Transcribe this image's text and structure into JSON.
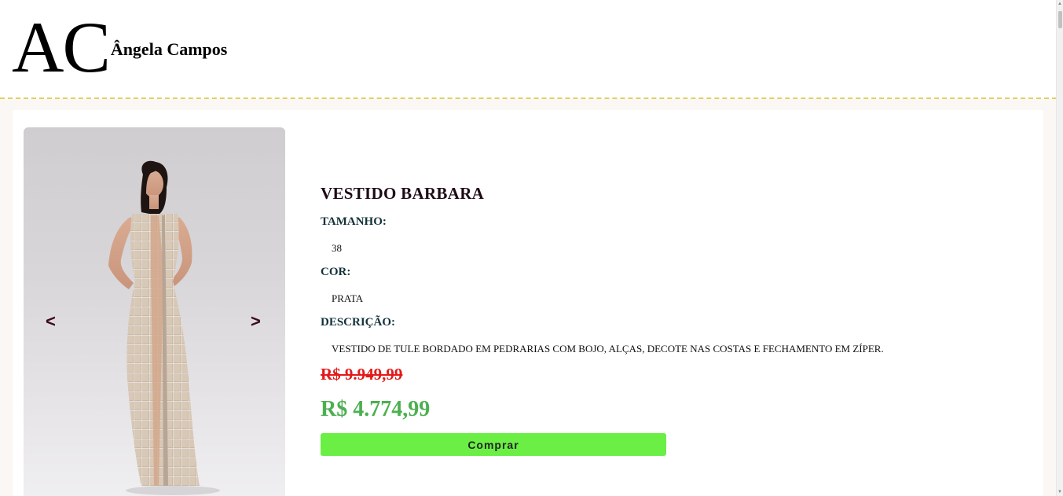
{
  "header": {
    "logo_mark": "AC",
    "brand_name": "Ângela Campos"
  },
  "product": {
    "title": "VESTIDO BARBARA",
    "size_label": "TAMANHO:",
    "size_value": "38",
    "color_label": "COR:",
    "color_value": "PRATA",
    "description_label": "DESCRIÇÃO:",
    "description_value": "VESTIDO DE TULE BORDADO EM PEDRARIAS COM BOJO, ALÇAS, DECOTE NAS COSTAS E FECHAMENTO EM ZÍPER.",
    "old_price": "R$ 9.949,99",
    "new_price": "R$ 4.774,99",
    "buy_label": "Comprar"
  },
  "carousel": {
    "prev_label": "<",
    "next_label": ">",
    "image_icon": "product-photo-silver-dress"
  },
  "colors": {
    "accent_border": "#e3cf63",
    "old_price": "#e31a1a",
    "new_price": "#4caf50",
    "buy_button": "#6bef45",
    "label_text": "#13313a"
  }
}
